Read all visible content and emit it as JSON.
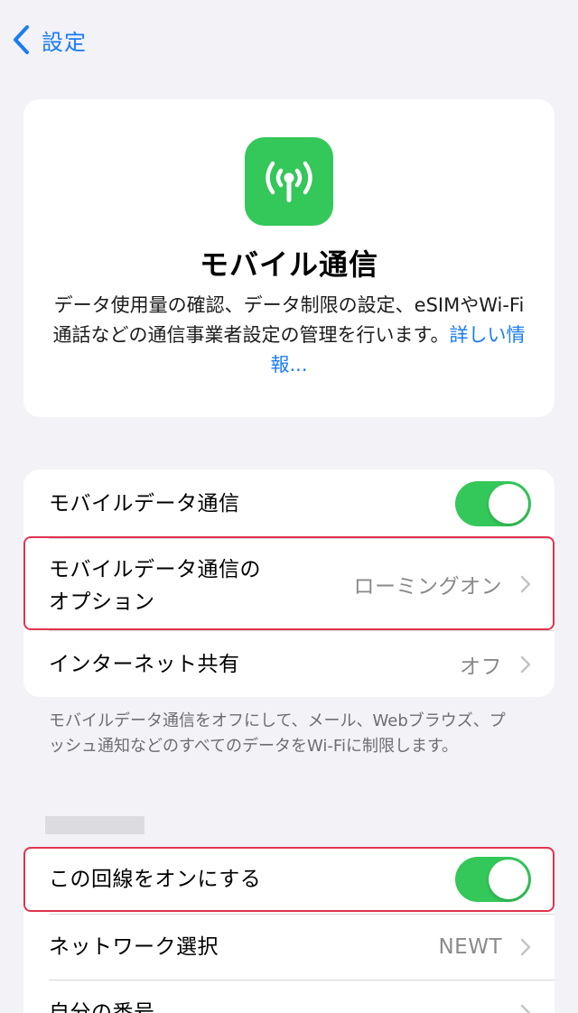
{
  "nav": {
    "back_label": "設定"
  },
  "info": {
    "icon": "antenna-radiowaves-icon",
    "title": "モバイル通信",
    "description": "データ使用量の確認、データ制限の設定、eSIMやWi-Fi通話などの通信事業者設定の管理を行います。",
    "link": "詳しい情報..."
  },
  "cellular_group": {
    "mobile_data": {
      "label": "モバイルデータ通信",
      "enabled": true
    },
    "data_options": {
      "label_line1": "モバイルデータ通信の",
      "label_line2": "オプション",
      "value": "ローミングオン"
    },
    "hotspot": {
      "label": "インターネット共有",
      "value": "オフ"
    }
  },
  "footnote": "モバイルデータ通信をオフにして、メール、Webブラウズ、プッシュ通知などのすべてのデータをWi-Fiに制限します。",
  "line_group": {
    "turn_on_line": {
      "label": "この回線をオンにする",
      "enabled": true
    },
    "network_selection": {
      "label": "ネットワーク選択",
      "value": "NEWT"
    },
    "my_number": {
      "label": "自分の番号"
    }
  },
  "colors": {
    "accent": "#1a7cf5",
    "toggle_on": "#34c759",
    "highlight": "#e0344e"
  }
}
